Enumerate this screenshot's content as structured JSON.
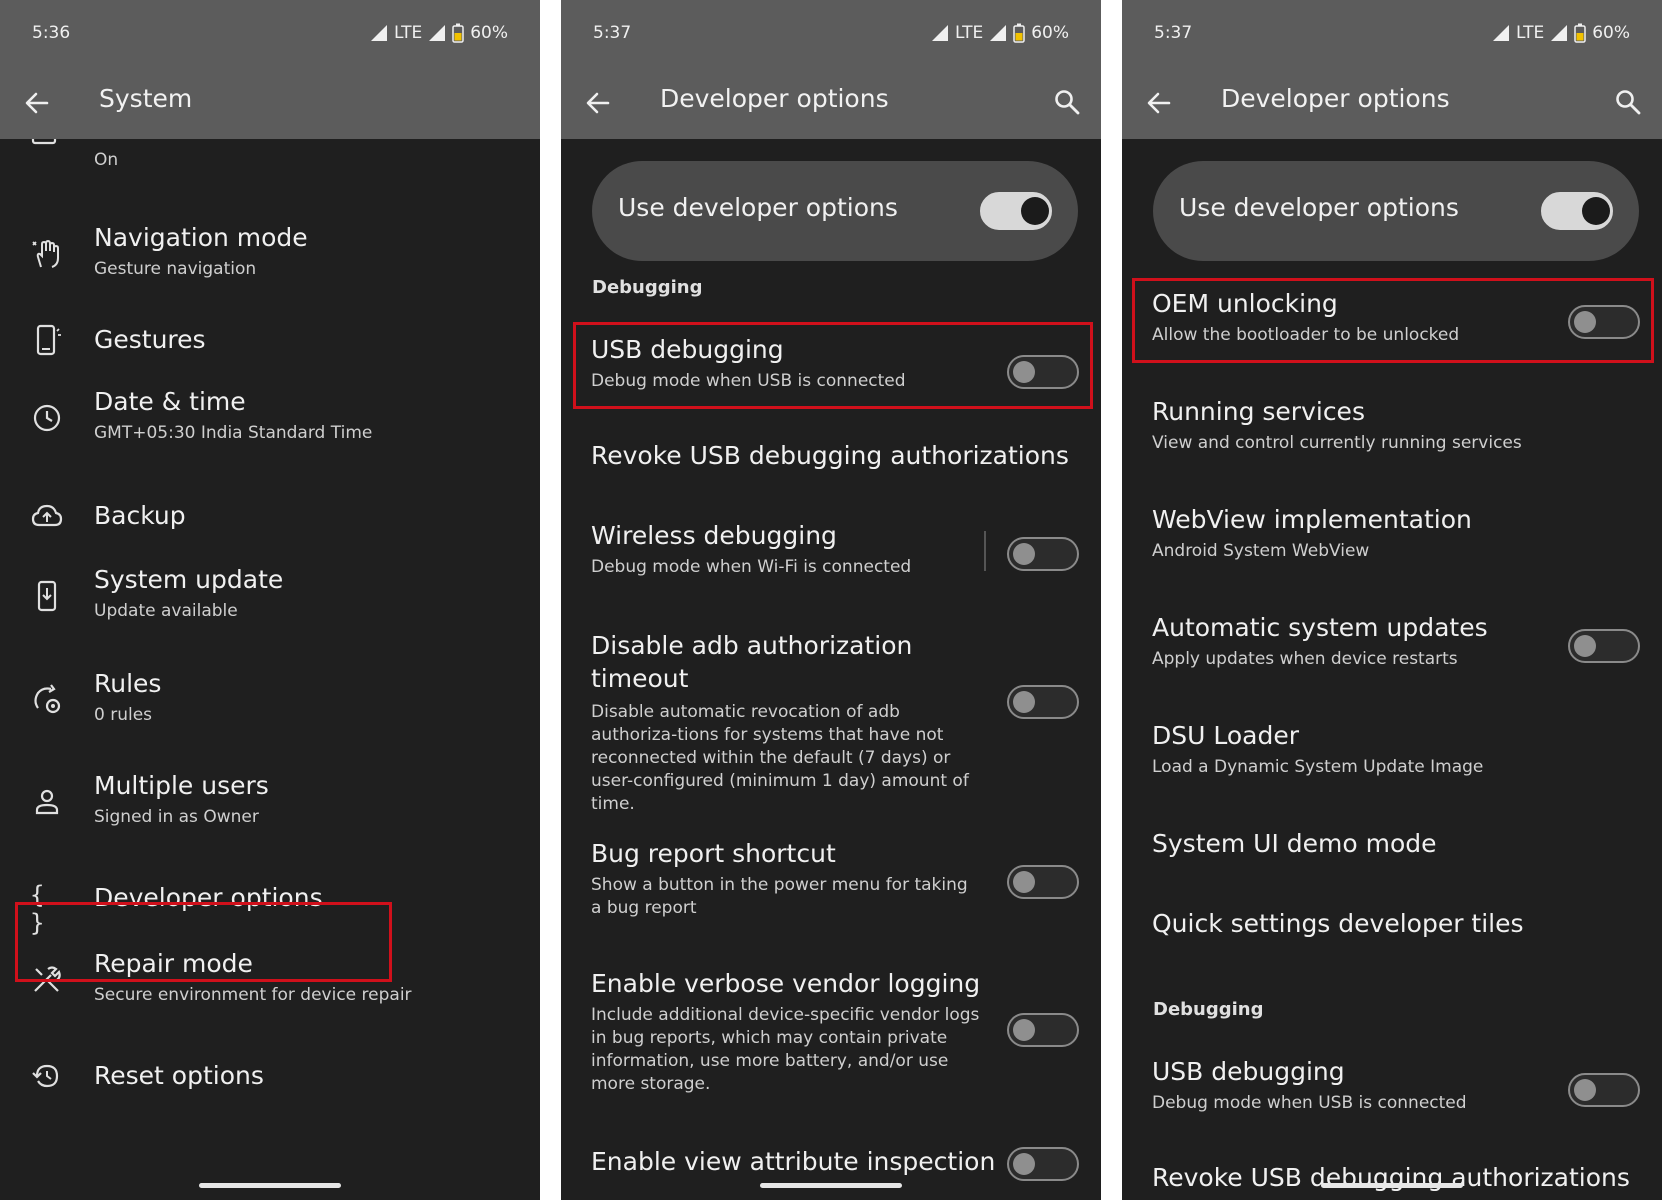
{
  "colors": {
    "panel_bg": "#1f1f1f",
    "bar_bg": "#5c5c5c",
    "highlight": "#d0101b"
  },
  "status": {
    "signal_icon": "signal-icon",
    "battery_icon": "battery-icon",
    "p1": {
      "time": "5:36",
      "network": "LTE",
      "battery": "60%"
    },
    "p2": {
      "time": "5:37",
      "network": "LTE",
      "battery": "60%"
    },
    "p3": {
      "time": "5:37",
      "network": "LTE",
      "battery": "60%"
    }
  },
  "panel1": {
    "title": "System",
    "items": [
      {
        "title": "",
        "subtitle": "On",
        "icon": "keyboard-icon"
      },
      {
        "title": "Navigation mode",
        "subtitle": "Gesture navigation",
        "icon": "gesture-hand-icon"
      },
      {
        "title": "Gestures",
        "subtitle": "",
        "icon": "phone-gesture-icon"
      },
      {
        "title": "Date & time",
        "subtitle": "GMT+05:30 India Standard Time",
        "icon": "clock-icon"
      },
      {
        "title": "Backup",
        "subtitle": "",
        "icon": "cloud-upload-icon"
      },
      {
        "title": "System update",
        "subtitle": "Update available",
        "icon": "system-update-icon"
      },
      {
        "title": "Rules",
        "subtitle": "0 rules",
        "icon": "rules-icon"
      },
      {
        "title": "Multiple users",
        "subtitle": "Signed in as Owner",
        "icon": "person-icon"
      },
      {
        "title": "Developer options",
        "subtitle": "",
        "icon": "braces-icon"
      },
      {
        "title": "Repair mode",
        "subtitle": "Secure environment for device repair",
        "icon": "tools-icon"
      },
      {
        "title": "Reset options",
        "subtitle": "",
        "icon": "reset-icon"
      }
    ]
  },
  "panel2": {
    "title": "Developer options",
    "master_label": "Use developer options",
    "section": "Debugging",
    "items": [
      {
        "title": "USB debugging",
        "subtitle": "Debug mode when USB is connected",
        "toggle": "off"
      },
      {
        "title": "Revoke USB debugging authorizations",
        "subtitle": ""
      },
      {
        "title": "Wireless debugging",
        "subtitle": "Debug mode when Wi-Fi is connected",
        "toggle": "off"
      },
      {
        "title": "Disable adb authorization timeout",
        "subtitle": "Disable automatic revocation of adb authoriza-tions for systems that have not reconnected within the default (7 days) or user-configured (minimum 1 day) amount of time.",
        "toggle": "off"
      },
      {
        "title": "Bug report shortcut",
        "subtitle": "Show a button in the power menu for taking a bug report",
        "toggle": "off"
      },
      {
        "title": "Enable verbose vendor logging",
        "subtitle": "Include additional device-specific vendor logs in bug reports, which may contain private information, use more battery, and/or use more storage.",
        "toggle": "off"
      },
      {
        "title": "Enable view attribute inspection",
        "subtitle": "",
        "toggle": "off"
      }
    ]
  },
  "panel3": {
    "title": "Developer options",
    "master_label": "Use developer options",
    "section": "Debugging",
    "items": [
      {
        "title": "OEM unlocking",
        "subtitle": "Allow the bootloader to be unlocked",
        "toggle": "off"
      },
      {
        "title": "Running services",
        "subtitle": "View and control currently running services"
      },
      {
        "title": "WebView implementation",
        "subtitle": "Android System WebView"
      },
      {
        "title": "Automatic system updates",
        "subtitle": "Apply updates when device restarts",
        "toggle": "off"
      },
      {
        "title": "DSU Loader",
        "subtitle": "Load a Dynamic System Update Image"
      },
      {
        "title": "System UI demo mode",
        "subtitle": ""
      },
      {
        "title": "Quick settings developer tiles",
        "subtitle": ""
      },
      {
        "title": "USB debugging",
        "subtitle": "Debug mode when USB is connected",
        "toggle": "off"
      },
      {
        "title": "Revoke USB debugging authorizations",
        "subtitle": ""
      }
    ]
  }
}
